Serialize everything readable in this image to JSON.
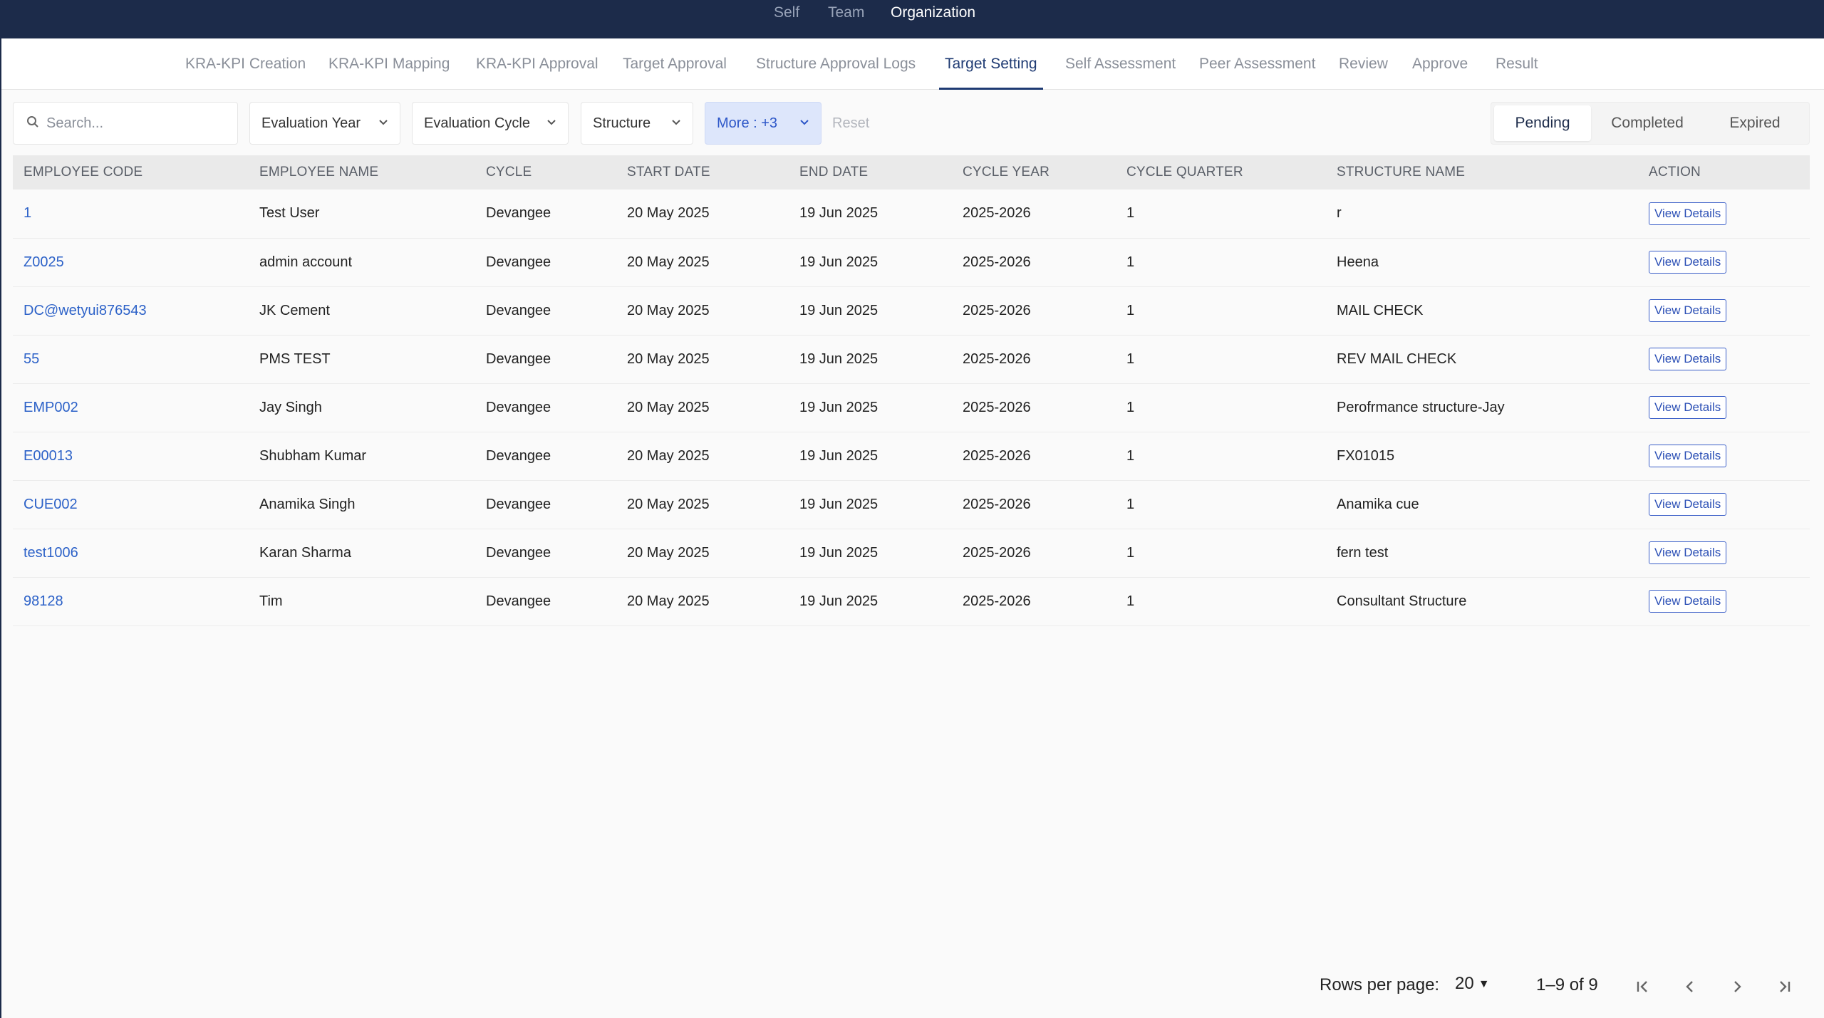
{
  "topnav": {
    "items": [
      {
        "label": "Self"
      },
      {
        "label": "Team"
      },
      {
        "label": "Organization"
      }
    ]
  },
  "subtabs": [
    {
      "label": "KRA-KPI Creation"
    },
    {
      "label": "KRA-KPI Mapping"
    },
    {
      "label": "KRA-KPI Approval"
    },
    {
      "label": "Target Approval"
    },
    {
      "label": "Structure Approval Logs"
    },
    {
      "label": "Target Setting",
      "active": true
    },
    {
      "label": "Self Assessment"
    },
    {
      "label": "Peer Assessment"
    },
    {
      "label": "Review"
    },
    {
      "label": "Approve"
    },
    {
      "label": "Result"
    }
  ],
  "filters": {
    "search_placeholder": "Search...",
    "evaluation_year": "Evaluation Year",
    "evaluation_cycle": "Evaluation Cycle",
    "structure": "Structure",
    "more": "More : +3",
    "reset": "Reset"
  },
  "status_tabs": [
    {
      "label": "Pending",
      "active": true
    },
    {
      "label": "Completed"
    },
    {
      "label": "Expired"
    }
  ],
  "table": {
    "headers": [
      "EMPLOYEE CODE",
      "EMPLOYEE NAME",
      "CYCLE",
      "START DATE",
      "END DATE",
      "CYCLE YEAR",
      "CYCLE QUARTER",
      "STRUCTURE NAME",
      "ACTION"
    ],
    "action_label": "View Details",
    "rows": [
      {
        "code": "1",
        "name": "Test User",
        "cycle": "Devangee",
        "start": "20 May 2025",
        "end": "19 Jun 2025",
        "year": "2025-2026",
        "quarter": "1",
        "structure": "r"
      },
      {
        "code": "Z0025",
        "name": "admin account",
        "cycle": "Devangee",
        "start": "20 May 2025",
        "end": "19 Jun 2025",
        "year": "2025-2026",
        "quarter": "1",
        "structure": "Heena"
      },
      {
        "code": "DC@wetyui876543",
        "name": "JK Cement",
        "cycle": "Devangee",
        "start": "20 May 2025",
        "end": "19 Jun 2025",
        "year": "2025-2026",
        "quarter": "1",
        "structure": "MAIL CHECK"
      },
      {
        "code": "55",
        "name": "PMS TEST",
        "cycle": "Devangee",
        "start": "20 May 2025",
        "end": "19 Jun 2025",
        "year": "2025-2026",
        "quarter": "1",
        "structure": "REV MAIL CHECK"
      },
      {
        "code": "EMP002",
        "name": "Jay Singh",
        "cycle": "Devangee",
        "start": "20 May 2025",
        "end": "19 Jun 2025",
        "year": "2025-2026",
        "quarter": "1",
        "structure": "Perofrmance structure-Jay"
      },
      {
        "code": "E00013",
        "name": "Shubham Kumar",
        "cycle": "Devangee",
        "start": "20 May 2025",
        "end": "19 Jun 2025",
        "year": "2025-2026",
        "quarter": "1",
        "structure": "FX01015"
      },
      {
        "code": "CUE002",
        "name": "Anamika Singh",
        "cycle": "Devangee",
        "start": "20 May 2025",
        "end": "19 Jun 2025",
        "year": "2025-2026",
        "quarter": "1",
        "structure": "Anamika cue"
      },
      {
        "code": "test1006",
        "name": "Karan Sharma",
        "cycle": "Devangee",
        "start": "20 May 2025",
        "end": "19 Jun 2025",
        "year": "2025-2026",
        "quarter": "1",
        "structure": "fern test"
      },
      {
        "code": "98128",
        "name": "Tim",
        "cycle": "Devangee",
        "start": "20 May 2025",
        "end": "19 Jun 2025",
        "year": "2025-2026",
        "quarter": "1",
        "structure": "Consultant Structure"
      }
    ]
  },
  "pagination": {
    "rows_per_page_label": "Rows per page:",
    "rows_per_page": "20",
    "range": "1–9 of 9"
  },
  "colors": {
    "topbar": "#1c2b4a",
    "accent": "#1f3b73",
    "link": "#2d62c8"
  }
}
